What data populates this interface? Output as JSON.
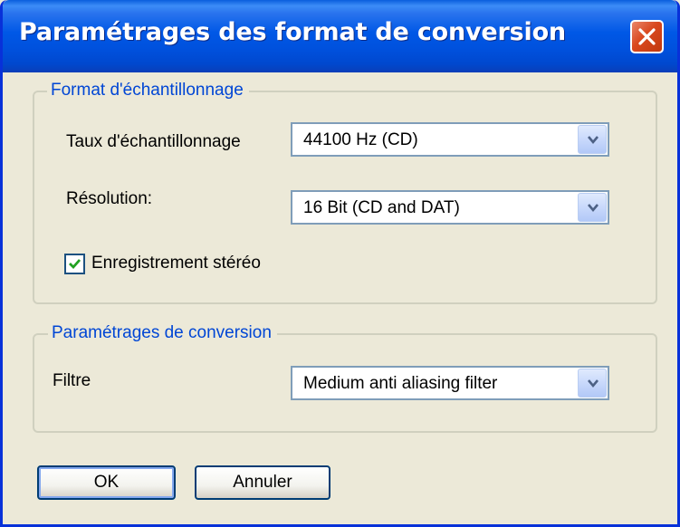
{
  "window": {
    "title": "Paramétrages des format de conversion",
    "close_icon": "close-icon"
  },
  "sampling_group": {
    "legend": "Format d'échantillonnage",
    "rate_label": "Taux d'échantillonnage",
    "rate_value": "44100 Hz (CD)",
    "resolution_label": "Résolution:",
    "resolution_value": "16 Bit (CD and DAT)",
    "stereo_label": "Enregistrement stéréo",
    "stereo_checked": true
  },
  "conversion_group": {
    "legend": "Paramétrages de conversion",
    "filter_label": "Filtre",
    "filter_value": "Medium anti aliasing filter"
  },
  "buttons": {
    "ok_label": "OK",
    "cancel_label": "Annuler"
  },
  "colors": {
    "titlebar": "#0058E6",
    "dialog_bg": "#ECE9D8",
    "legend_text": "#0046D5",
    "close_button": "#D9481E"
  }
}
